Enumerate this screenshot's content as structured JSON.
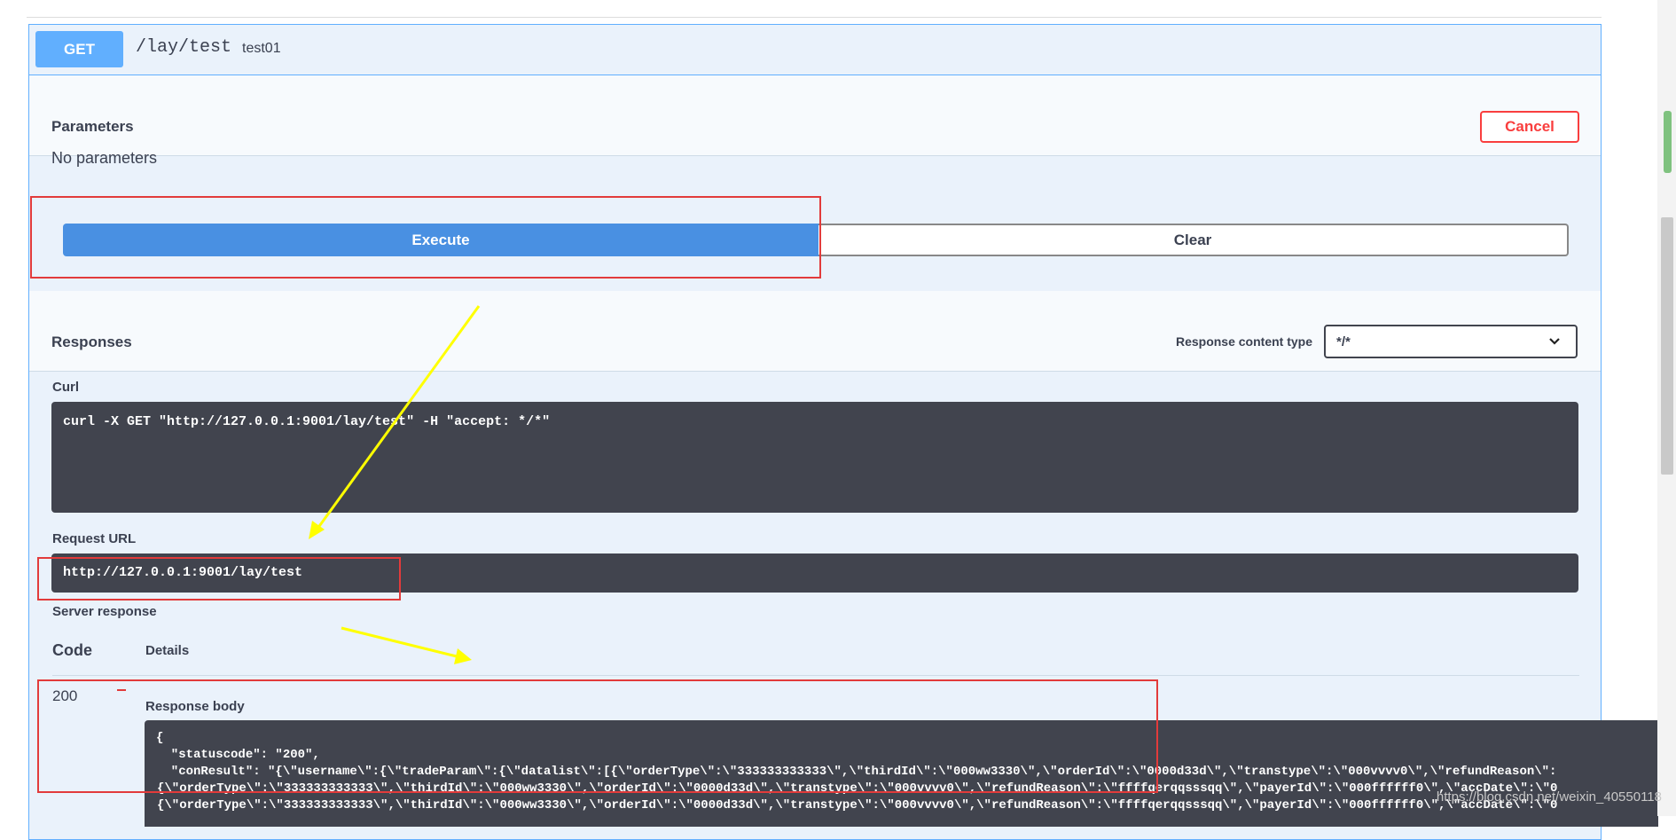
{
  "endpoint": {
    "method": "GET",
    "path": "/lay/test",
    "description": "test01"
  },
  "parameters": {
    "title": "Parameters",
    "cancel_label": "Cancel",
    "empty_text": "No parameters"
  },
  "actions": {
    "execute_label": "Execute",
    "clear_label": "Clear"
  },
  "responses": {
    "title": "Responses",
    "content_type_label": "Response content type",
    "content_type_value": "*/*"
  },
  "curl": {
    "label": "Curl",
    "command": "curl -X GET \"http://127.0.0.1:9001/lay/test\" -H \"accept: */*\""
  },
  "request_url": {
    "label": "Request URL",
    "value": "http://127.0.0.1:9001/lay/test"
  },
  "server_response": {
    "label": "Server response",
    "code_header": "Code",
    "details_header": "Details",
    "code": "200",
    "body_label": "Response body",
    "body_lines": [
      "{",
      "  \"statuscode\": \"200\",",
      "  \"conResult\": \"{\\\"username\\\":{\\\"tradeParam\\\":{\\\"datalist\\\":[{\\\"orderType\\\":\\\"333333333333\\\",\\\"thirdId\\\":\\\"000ww3330\\\",\\\"orderId\\\":\\\"0000d33d\\\",\\\"transtype\\\":\\\"000vvvv0\\\",\\\"refundReason\\\":",
      "{\\\"orderType\\\":\\\"333333333333\\\",\\\"thirdId\\\":\\\"000ww3330\\\",\\\"orderId\\\":\\\"0000d33d\\\",\\\"transtype\\\":\\\"000vvvv0\\\",\\\"refundReason\\\":\\\"ffffqerqqsssqq\\\",\\\"payerId\\\":\\\"000ffffff0\\\",\\\"accDate\\\":\\\"0",
      "{\\\"orderType\\\":\\\"333333333333\\\",\\\"thirdId\\\":\\\"000ww3330\\\",\\\"orderId\\\":\\\"0000d33d\\\",\\\"transtype\\\":\\\"000vvvv0\\\",\\\"refundReason\\\":\\\"ffffqerqqsssqq\\\",\\\"payerId\\\":\\\"000ffffff0\\\",\\\"accDate\\\":\\\"0"
    ]
  },
  "watermark": "https://blog.csdn.net/weixin_40550118",
  "colors": {
    "get": "#61affe",
    "execute": "#4990e2",
    "cancel": "#f93e3e",
    "annotation_red": "#e23b3b",
    "annotation_yellow": "#ffff00"
  }
}
